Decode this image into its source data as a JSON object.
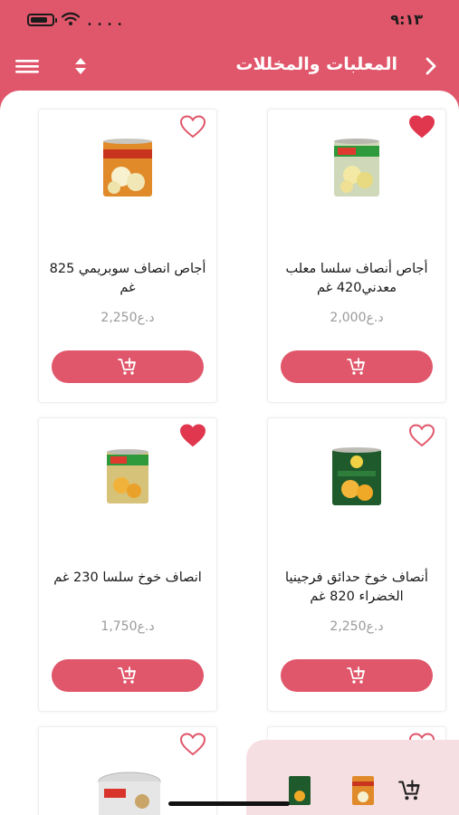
{
  "status": {
    "time": "٩:١٣",
    "battery_level": 0.8
  },
  "header": {
    "title": "المعلبات والمخللات"
  },
  "currency": "د.ع",
  "products": [
    {
      "name": "أجاص أنصاف سلسا معلب معدني420 غم",
      "price": "2,000",
      "favorite": true
    },
    {
      "name": "أجاص انصاف سوبريمي 825 غم",
      "price": "2,250",
      "favorite": false
    },
    {
      "name": "أنصاف خوخ حدائق فرجينيا الخضراء 820 غم",
      "price": "2,250",
      "favorite": false
    },
    {
      "name": "انصاف خوخ سلسا 230 غم",
      "price": "1,750",
      "favorite": true
    },
    {
      "name": "",
      "price": "",
      "favorite": false
    },
    {
      "name": "",
      "price": "",
      "favorite": false
    }
  ],
  "colors": {
    "accent": "#e0566a",
    "favorite": "#e0374f",
    "outline": "#e0566a",
    "price": "#9a9a9a"
  },
  "icons": [
    "back-chevron-icon",
    "sort-icon",
    "menu-icon",
    "heart-icon",
    "add-to-cart-icon"
  ]
}
